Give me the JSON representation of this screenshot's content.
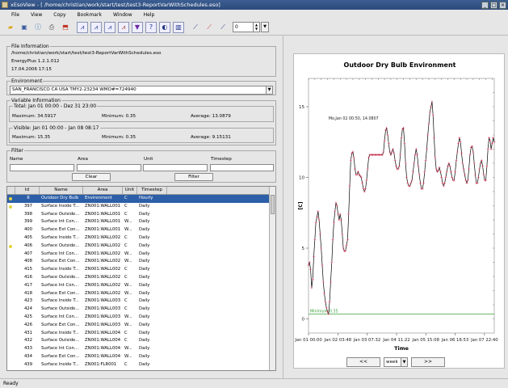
{
  "window": {
    "title": "xEsoView - [ /home/christian/work/start/test/test3-ReportVarWithSchedules.eso]",
    "minimize": "_",
    "maximize": "□",
    "close": "×"
  },
  "menu": [
    "File",
    "View",
    "Copy",
    "Bookmark",
    "Window",
    "Help"
  ],
  "toolbar": {
    "zoom_value": "0"
  },
  "file_info": {
    "legend": "File Information",
    "path": "/home/christian/work/start/test/test3-ReportVarWithSchedules.eso",
    "version": "EnergyPlus 1.2.1.012",
    "date": "17.04.2006 17:15"
  },
  "environment": {
    "legend": "Environment",
    "selected": "SAN_FRANCISCO CA USA TMY2-23234 WMO#=724940"
  },
  "variable_info": {
    "legend": "Variable Information",
    "total": {
      "label": "Total: Jan 01 00:00 - Dez 31 23:00",
      "maximum": "Maximum: 34.5917",
      "minimum": "Minimum: 0.35",
      "average": "Average: 13.0879"
    },
    "visible": {
      "label": "Visible: Jan 01 00:00 - Jan 08 08:17",
      "maximum": "Maximum: 15.35",
      "minimum": "Minimum: 0.35",
      "average": "Average: 9.15131"
    }
  },
  "filter": {
    "legend": "Filter",
    "name_label": "Name",
    "area_label": "Area",
    "unit_label": "Unit",
    "timestep_label": "Timestep",
    "clear_label": "Clear",
    "filter_label": "Filter"
  },
  "table": {
    "headers": [
      "",
      "Id",
      "Name",
      "Area",
      "Unit",
      "Timestep"
    ],
    "rows": [
      {
        "id": "6",
        "name": "Outdoor Dry Bulb",
        "area": "Environment",
        "unit": "C",
        "timestep": "Hourly",
        "selected": true,
        "dot": true
      },
      {
        "id": "397",
        "name": "Surface Inside T...",
        "area": "ZN001:WALL001",
        "unit": "C",
        "timestep": "Daily",
        "dot": true
      },
      {
        "id": "398",
        "name": "Surface Outside...",
        "area": "ZN001:WALL001",
        "unit": "C",
        "timestep": "Daily"
      },
      {
        "id": "399",
        "name": "Surface Int Con...",
        "area": "ZN001:WALL001",
        "unit": "W...",
        "timestep": "Daily"
      },
      {
        "id": "400",
        "name": "Surface Ext Con...",
        "area": "ZN001:WALL001",
        "unit": "W...",
        "timestep": "Daily"
      },
      {
        "id": "405",
        "name": "Surface Inside T...",
        "area": "ZN001:WALL002",
        "unit": "C",
        "timestep": "Daily"
      },
      {
        "id": "406",
        "name": "Surface Outside...",
        "area": "ZN001:WALL002",
        "unit": "C",
        "timestep": "Daily",
        "dot": true
      },
      {
        "id": "407",
        "name": "Surface Int Con...",
        "area": "ZN001:WALL002",
        "unit": "W...",
        "timestep": "Daily"
      },
      {
        "id": "408",
        "name": "Surface Ext Con...",
        "area": "ZN001:WALL002",
        "unit": "W...",
        "timestep": "Daily"
      },
      {
        "id": "415",
        "name": "Surface Inside T...",
        "area": "ZN001:WALL002",
        "unit": "C",
        "timestep": "Daily"
      },
      {
        "id": "416",
        "name": "Surface Outside...",
        "area": "ZN001:WALL002",
        "unit": "C",
        "timestep": "Daily"
      },
      {
        "id": "417",
        "name": "Surface Int Con...",
        "area": "ZN001:WALL002",
        "unit": "W...",
        "timestep": "Daily"
      },
      {
        "id": "418",
        "name": "Surface Ext Con...",
        "area": "ZN001:WALL002",
        "unit": "W...",
        "timestep": "Daily"
      },
      {
        "id": "423",
        "name": "Surface Inside T...",
        "area": "ZN001:WALL003",
        "unit": "C",
        "timestep": "Daily"
      },
      {
        "id": "424",
        "name": "Surface Outside...",
        "area": "ZN001:WALL003",
        "unit": "C",
        "timestep": "Daily"
      },
      {
        "id": "425",
        "name": "Surface Int Con...",
        "area": "ZN001:WALL003",
        "unit": "W...",
        "timestep": "Daily"
      },
      {
        "id": "426",
        "name": "Surface Ext Con...",
        "area": "ZN001:WALL003",
        "unit": "W...",
        "timestep": "Daily"
      },
      {
        "id": "431",
        "name": "Surface Inside T...",
        "area": "ZN001:WALL004",
        "unit": "C",
        "timestep": "Daily"
      },
      {
        "id": "432",
        "name": "Surface Outside...",
        "area": "ZN001:WALL004",
        "unit": "C",
        "timestep": "Daily"
      },
      {
        "id": "433",
        "name": "Surface Int Con...",
        "area": "ZN001:WALL004",
        "unit": "W...",
        "timestep": "Daily"
      },
      {
        "id": "434",
        "name": "Surface Ext Con...",
        "area": "ZN001:WALL004",
        "unit": "W...",
        "timestep": "Daily"
      },
      {
        "id": "439",
        "name": "Surface Inside T...",
        "area": "ZN001:FLR001",
        "unit": "C",
        "timestep": "Daily"
      }
    ]
  },
  "chart_nav": {
    "prev": "<<",
    "period": "week",
    "next": ">>"
  },
  "status": "Ready",
  "chart_data": {
    "type": "line",
    "title": "Outdoor Dry Bulb  Environment",
    "xlabel": "Time",
    "ylabel": "[C]",
    "ylim": [
      -1,
      17
    ],
    "xlim": [
      0,
      176
    ],
    "yticks": [
      0,
      5,
      10,
      15
    ],
    "xtick_labels": [
      "Jan 01 00:00",
      "Jan 02 03:48",
      "Jan 03 07:32",
      "Jan 04 11:22",
      "Jan 05 15:08",
      "Jan 06 18:53",
      "Jan 07 22:40"
    ],
    "xtick_hours": [
      0,
      27.8,
      55.5,
      83.4,
      111.1,
      138.9,
      166.7
    ],
    "max_annotation": "Mo,Jan 02 00:50, 14.0807",
    "min_annotation": "Minimum:0.35",
    "min_value": 0.35,
    "series": [
      {
        "values": [
          [
            0,
            3.8
          ],
          [
            1,
            4.0
          ],
          [
            2,
            3.5
          ],
          [
            3,
            2.2
          ],
          [
            4,
            2.8
          ],
          [
            5,
            4.4
          ],
          [
            6,
            5.6
          ],
          [
            7,
            6.8
          ],
          [
            8,
            7.2
          ],
          [
            9,
            7.6
          ],
          [
            10,
            7.0
          ],
          [
            11,
            6.0
          ],
          [
            12,
            5.0
          ],
          [
            13,
            3.8
          ],
          [
            14,
            2.6
          ],
          [
            15,
            1.8
          ],
          [
            16,
            1.2
          ],
          [
            17,
            0.8
          ],
          [
            18,
            0.5
          ],
          [
            19,
            0.35
          ],
          [
            20,
            1.2
          ],
          [
            21,
            2.6
          ],
          [
            22,
            4.0
          ],
          [
            23,
            5.6
          ],
          [
            24,
            6.8
          ],
          [
            25,
            7.6
          ],
          [
            26,
            8.2
          ],
          [
            27,
            8.0
          ],
          [
            28,
            7.4
          ],
          [
            29,
            7.0
          ],
          [
            30,
            7.4
          ],
          [
            31,
            7.0
          ],
          [
            32,
            6.0
          ],
          [
            33,
            5.0
          ],
          [
            34,
            4.8
          ],
          [
            35,
            4.8
          ],
          [
            36,
            5.2
          ],
          [
            37,
            5.6
          ],
          [
            38,
            7.4
          ],
          [
            39,
            9.4
          ],
          [
            40,
            11.2
          ],
          [
            41,
            11.7
          ],
          [
            42,
            11.8
          ],
          [
            43,
            11.4
          ],
          [
            44,
            10.6
          ],
          [
            45,
            10.2
          ],
          [
            46,
            10.2
          ],
          [
            47,
            10.4
          ],
          [
            48,
            10.2
          ],
          [
            49,
            10.1
          ],
          [
            50,
            10.0
          ],
          [
            51,
            9.6
          ],
          [
            52,
            9.2
          ],
          [
            53,
            9.0
          ],
          [
            54,
            9.2
          ],
          [
            55,
            9.8
          ],
          [
            56,
            10.6
          ],
          [
            57,
            11.4
          ],
          [
            58,
            11.6
          ],
          [
            59,
            11.6
          ],
          [
            60,
            11.6
          ],
          [
            61,
            11.6
          ],
          [
            62,
            11.6
          ],
          [
            63,
            11.6
          ],
          [
            64,
            11.6
          ],
          [
            65,
            11.6
          ],
          [
            66,
            11.6
          ],
          [
            67,
            11.6
          ],
          [
            68,
            11.6
          ],
          [
            69,
            11.6
          ],
          [
            70,
            11.6
          ],
          [
            71,
            11.8
          ],
          [
            72,
            12.6
          ],
          [
            73,
            13.3
          ],
          [
            74,
            13.5
          ],
          [
            75,
            13.0
          ],
          [
            76,
            12.4
          ],
          [
            77,
            11.8
          ],
          [
            78,
            11.6
          ],
          [
            79,
            11.8
          ],
          [
            80,
            12.0
          ],
          [
            81,
            11.7
          ],
          [
            82,
            11.2
          ],
          [
            83,
            10.8
          ],
          [
            84,
            10.6
          ],
          [
            85,
            10.6
          ],
          [
            86,
            10.8
          ],
          [
            87,
            11.6
          ],
          [
            88,
            12.8
          ],
          [
            89,
            13.4
          ],
          [
            90,
            13.5
          ],
          [
            91,
            12.4
          ],
          [
            92,
            11.0
          ],
          [
            93,
            10.0
          ],
          [
            94,
            9.6
          ],
          [
            95,
            9.4
          ],
          [
            96,
            9.4
          ],
          [
            97,
            9.6
          ],
          [
            98,
            9.8
          ],
          [
            99,
            10.4
          ],
          [
            100,
            11.0
          ],
          [
            101,
            11.6
          ],
          [
            102,
            12.0
          ],
          [
            103,
            11.6
          ],
          [
            104,
            10.8
          ],
          [
            105,
            10.2
          ],
          [
            106,
            9.6
          ],
          [
            107,
            9.2
          ],
          [
            108,
            9.2
          ],
          [
            109,
            9.6
          ],
          [
            110,
            10.4
          ],
          [
            111,
            11.2
          ],
          [
            112,
            12.0
          ],
          [
            113,
            13.0
          ],
          [
            114,
            13.8
          ],
          [
            115,
            14.6
          ],
          [
            116,
            15.0
          ],
          [
            117,
            15.35
          ],
          [
            118,
            14.4
          ],
          [
            119,
            12.8
          ],
          [
            120,
            11.4
          ],
          [
            121,
            10.6
          ],
          [
            122,
            10.4
          ],
          [
            123,
            10.5
          ],
          [
            124,
            10.7
          ],
          [
            125,
            10.4
          ],
          [
            126,
            10.0
          ],
          [
            127,
            9.6
          ],
          [
            128,
            9.4
          ],
          [
            129,
            9.6
          ],
          [
            130,
            10.0
          ],
          [
            131,
            10.4
          ],
          [
            132,
            10.8
          ],
          [
            133,
            11.0
          ],
          [
            134,
            10.8
          ],
          [
            135,
            10.4
          ],
          [
            136,
            10.0
          ],
          [
            137,
            9.8
          ],
          [
            138,
            9.8
          ],
          [
            139,
            10.4
          ],
          [
            140,
            11.2
          ],
          [
            141,
            11.8
          ],
          [
            142,
            12.4
          ],
          [
            143,
            12.8
          ],
          [
            144,
            12.5
          ],
          [
            145,
            11.7
          ],
          [
            146,
            11.0
          ],
          [
            147,
            10.6
          ],
          [
            148,
            10.2
          ],
          [
            149,
            9.8
          ],
          [
            150,
            9.6
          ],
          [
            151,
            9.8
          ],
          [
            152,
            10.6
          ],
          [
            153,
            11.6
          ],
          [
            154,
            12.1
          ],
          [
            155,
            12.2
          ],
          [
            156,
            11.8
          ],
          [
            157,
            11.0
          ],
          [
            158,
            10.2
          ],
          [
            159,
            9.6
          ],
          [
            160,
            9.6
          ],
          [
            161,
            10.0
          ],
          [
            162,
            10.6
          ],
          [
            163,
            11.0
          ],
          [
            164,
            11.2
          ],
          [
            165,
            10.8
          ],
          [
            166,
            10.2
          ],
          [
            167,
            9.8
          ],
          [
            168,
            9.8
          ],
          [
            169,
            10.8
          ],
          [
            170,
            12.0
          ],
          [
            171,
            12.8
          ],
          [
            172,
            12.6
          ],
          [
            173,
            12.0
          ],
          [
            174,
            12.4
          ],
          [
            175,
            12.8
          ],
          [
            176,
            12.5
          ]
        ]
      }
    ],
    "colors": {
      "line": "#000000",
      "marker": "#d23c5a",
      "min_line": "#3aa03a"
    }
  }
}
